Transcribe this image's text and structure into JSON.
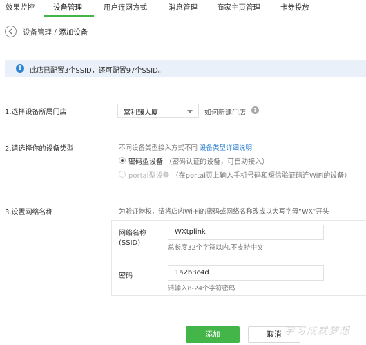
{
  "tabs": [
    {
      "label": "效果监控",
      "active": false
    },
    {
      "label": "设备管理",
      "active": true
    },
    {
      "label": "用户连网方式",
      "active": false
    },
    {
      "label": "消息管理",
      "active": false
    },
    {
      "label": "商家主页管理",
      "active": false
    },
    {
      "label": "卡券投放",
      "active": false
    }
  ],
  "breadcrumb": {
    "parent": "设备管理",
    "separator": " / ",
    "current": "添加设备",
    "back_icon": "chevron-left-circle-icon"
  },
  "info_bar": {
    "icon": "info-icon",
    "text": "此店已配置3个SSID，还可配置97个SSID。"
  },
  "step1": {
    "label": "1.选择设备所属门店",
    "select_value": "富利臻大厦",
    "new_store_link": "如何新建门店",
    "help_icon": "question-icon"
  },
  "step2": {
    "label": "2.请选择你的设备类型",
    "hint_prefix": "不同设备类型接入方式不同 ",
    "hint_link": "设备类型详细说明",
    "options": [
      {
        "label": "密码型设备",
        "sub": "（密码认证的设备，可自助接入）",
        "selected": true,
        "disabled": false
      },
      {
        "label": "portal型设备",
        "sub": "（在portal页上输入手机号码和短信验证码连WiFi的设备）",
        "selected": false,
        "disabled": true
      }
    ]
  },
  "step3": {
    "label": "3.设置网络名称",
    "hint": "为验证物权，请将店内Wi-Fi的密码或网络名称改成以大写字母“WX”开头",
    "ssid_label_line1": "网络名称",
    "ssid_label_line2": "(SSID)",
    "ssid_value": "WXtplink",
    "ssid_hint": "总长度32个字符以内,不支持中文",
    "password_label": "密码",
    "password_value": "1a2b3c4d",
    "password_hint": "请输入8-24个字符密码"
  },
  "buttons": {
    "add": "添加",
    "cancel": "取消"
  },
  "watermark": "学习成就梦想",
  "colors": {
    "accent": "#44b549",
    "link": "#2c7fd1",
    "info_bg": "#e9f0f9",
    "info_icon": "#2c84d6"
  }
}
